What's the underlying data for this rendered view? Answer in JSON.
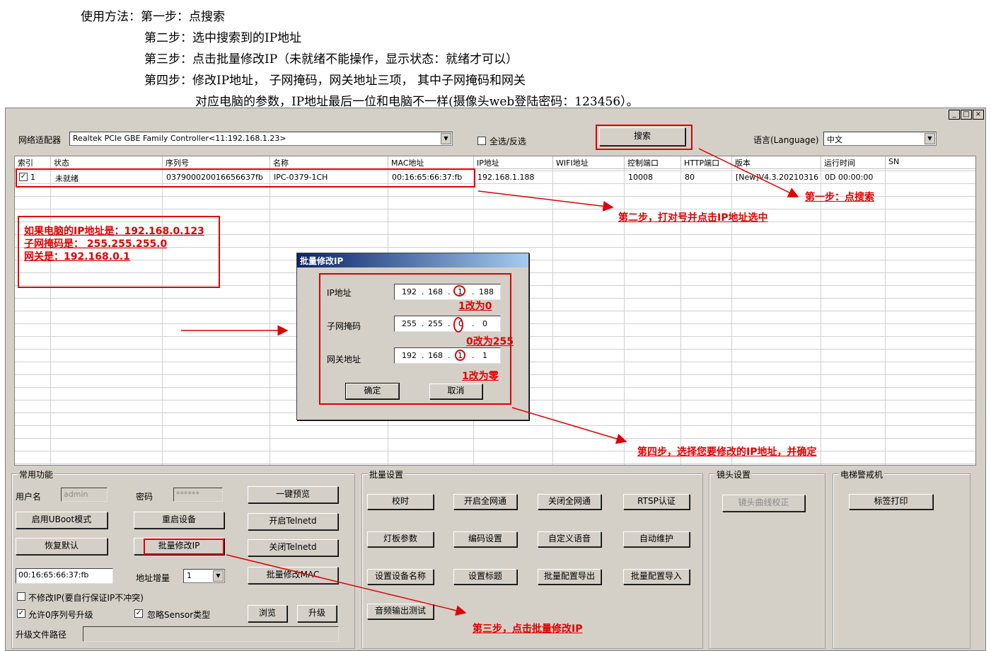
{
  "instructions": {
    "line1": "使用方法：第一步：点搜索",
    "line2": "第二步：选中搜索到的IP地址",
    "line3": "第三步：点击批量修改IP（未就绪不能操作，显示状态：就绪才可以）",
    "line4": "第四步：修改IP地址，  子网掩码，网关地址三项，  其中子网掩码和网关",
    "line5": "对应电脑的参数，IP地址最后一位和电脑不一样(摄像头web登陆密码：123456）。"
  },
  "window": {
    "controls": [
      "_",
      "□",
      "×"
    ]
  },
  "toolbar": {
    "adapter_label": "网络适配器",
    "adapter_value": "Realtek PCIe GBE Family Controller<11:192.168.1.23>",
    "select_all_label": "全选/反选",
    "search_button": "搜索",
    "language_label": "语言(Language)",
    "language_value": "中文"
  },
  "grid": {
    "headers": [
      "索引",
      "状态",
      "序列号",
      "名称",
      "MAC地址",
      "IP地址",
      "WIFI地址",
      "控制端口",
      "HTTP端口",
      "版本",
      "运行时间",
      "SN"
    ],
    "row": {
      "index": "1",
      "status": "未就绪",
      "serial": "037900020016656637fb",
      "name": "IPC-0379-1CH",
      "mac": "00:16:65:66:37:fb",
      "ip": "192.168.1.188",
      "wifi": "",
      "ctrl_port": "10008",
      "http_port": "80",
      "version": "[New]V4.3.20210316",
      "uptime": "0D 00:00:00",
      "sn": ""
    }
  },
  "dialog": {
    "title": "批量修改IP",
    "ip_label": "IP地址",
    "ip": [
      "192",
      "168",
      "1",
      "188"
    ],
    "mask_label": "子网掩码",
    "mask": [
      "255",
      "255",
      "0",
      "0"
    ],
    "gw_label": "网关地址",
    "gw": [
      "192",
      "168",
      "1",
      "1"
    ],
    "ok": "确定",
    "cancel": "取消"
  },
  "common": {
    "title": "常用功能",
    "user_label": "用户名",
    "user_value": "admin",
    "pwd_label": "密码",
    "pwd_value": "******",
    "one_key_preview": "一键预览",
    "uboot": "启用UBoot模式",
    "reboot": "重启设备",
    "open_telnet": "开启Telnetd",
    "restore": "恢复默认",
    "batch_ip": "批量修改IP",
    "close_telnet": "关闭Telnetd",
    "mac_value": "00:16:65:66:37:fb",
    "addr_inc_label": "地址增量",
    "addr_inc_value": "1",
    "batch_mac": "批量修改MAC",
    "no_ip_change": "不修改IP(要自行保证IP不冲突)",
    "allow_serial": "允许0序列号升级",
    "ignore_sensor": "忽略Sensor类型",
    "browse": "浏览",
    "upgrade": "升级",
    "upgrade_path_label": "升级文件路径"
  },
  "batch": {
    "title": "批量设置",
    "buttons": [
      "校时",
      "开启全网通",
      "关闭全网通",
      "RTSP认证",
      "灯板参数",
      "编码设置",
      "自定义语音",
      "自动维护",
      "设置设备名称",
      "设置标题",
      "批量配置导出",
      "批量配置导入",
      "音频输出测试"
    ]
  },
  "lens": {
    "title": "镜头设置",
    "curve": "镜头曲线校正"
  },
  "elevator": {
    "title": "电梯警戒机",
    "print": "标签打印"
  },
  "annotations": {
    "step1": "第一步：点搜索",
    "step2": "第二步，打对号并点击IP地址选中",
    "step3": "第三步，点击批量修改IP",
    "step4": "第四步，选择您要修改的IP地址，并确定",
    "note1": "如果电脑的IP地址是：192.168.0.123",
    "note2": " 子网掩码是： 255.255.255.0",
    "note3": "网关是：192.168.0.1",
    "fix_ip": "1改为0",
    "fix_mask": "0改为255",
    "fix_gw": "1改为零"
  },
  "colors": {
    "annotation": "#e00000",
    "dialog_title": "#0a246a",
    "window_bg": "#d4d0c8"
  }
}
